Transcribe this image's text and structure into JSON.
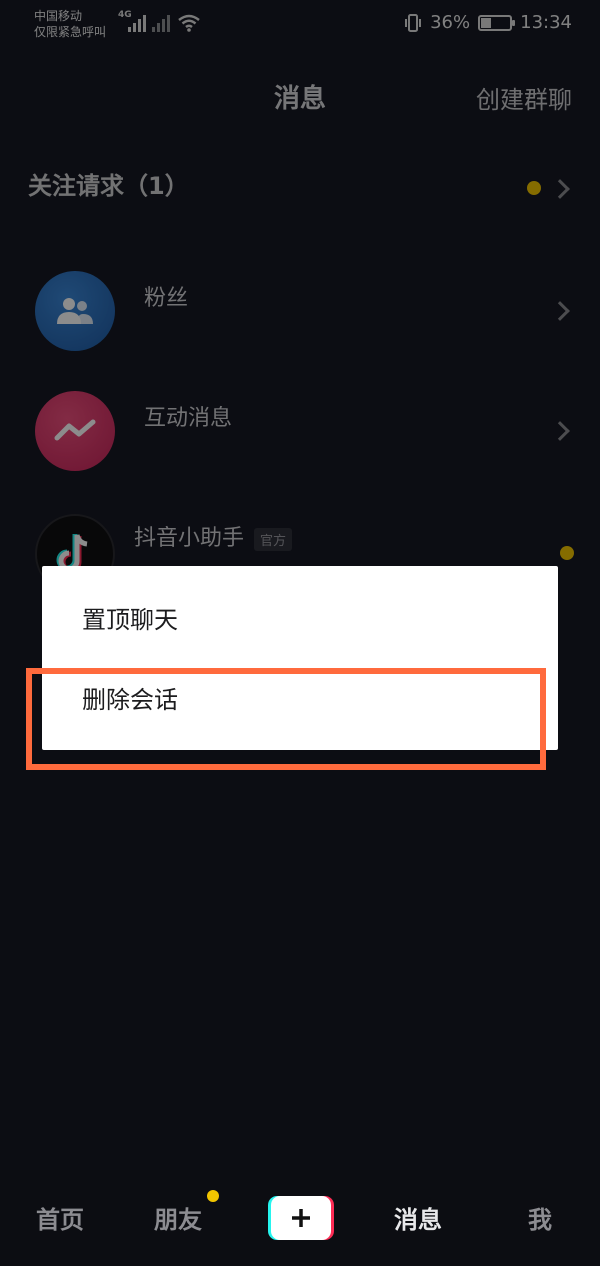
{
  "status_bar": {
    "carrier_line1": "中国移动",
    "carrier_line2": "仅限紧急呼叫",
    "network": "4G",
    "battery": "36%",
    "battery_level": 0.36,
    "time": "13:34"
  },
  "header": {
    "title": "消息",
    "create_group": "创建群聊"
  },
  "follow_requests": {
    "label": "关注请求（1）"
  },
  "list": [
    {
      "title": "粉丝",
      "icon": "fans-icon",
      "color": "#2d6fb8"
    },
    {
      "title": "互动消息",
      "icon": "interaction-icon",
      "color": "#e23a6b"
    },
    {
      "title": "抖音小助手",
      "badge": "官方",
      "icon": "tiktok-logo-icon",
      "color": "#111111"
    }
  ],
  "context_menu": {
    "items": [
      "置顶聊天",
      "删除会话"
    ]
  },
  "tab_bar": {
    "home": "首页",
    "friends": "朋友",
    "messages": "消息",
    "me": "我"
  },
  "colors": {
    "accent_dot": "#f2c500",
    "highlight": "#ff6a3d"
  }
}
